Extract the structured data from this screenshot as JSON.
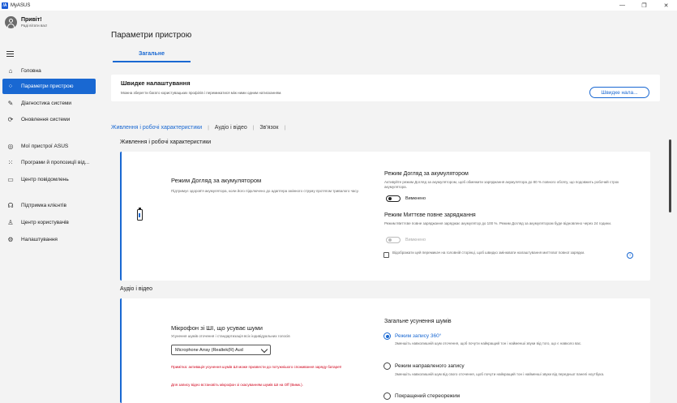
{
  "window": {
    "title": "MyASUS",
    "logo": "/A",
    "minimize": "—",
    "restore": "❐",
    "close": "✕"
  },
  "user": {
    "name": "Привіт!",
    "subtitle": "Раді вітати вас!"
  },
  "sidebar": {
    "items": [
      {
        "label": "Головна",
        "icon": "home-icon",
        "glyph": "⌂"
      },
      {
        "label": "Параметри пристрою",
        "icon": "grid-icon",
        "glyph": "⁘"
      },
      {
        "label": "Діагностика системи",
        "icon": "wrench-icon",
        "glyph": "✎"
      },
      {
        "label": "Оновлення системи",
        "icon": "update-icon",
        "glyph": "⟳"
      },
      {
        "label": "Мої пристрої ASUS",
        "icon": "devices-icon",
        "glyph": "◎"
      },
      {
        "label": "Програми й пропозиції від...",
        "icon": "apps-icon",
        "glyph": "⁙"
      },
      {
        "label": "Центр повідомлень",
        "icon": "message-icon",
        "glyph": "▭"
      },
      {
        "label": "Підтримка клієнтів",
        "icon": "support-icon",
        "glyph": "☊"
      },
      {
        "label": "Центр користувачів",
        "icon": "user-icon",
        "glyph": "♙"
      },
      {
        "label": "Налаштування",
        "icon": "gear-icon",
        "glyph": "⚙"
      }
    ]
  },
  "main": {
    "title": "Параметри пристрою",
    "tab_general": "Загальне",
    "quick": {
      "title": "Швидке налаштування",
      "desc": "Можна зберегти багато користувацьких профілів і перемикатися між ними одним натисканням.",
      "button": "Швидке нала..."
    },
    "subtabs": [
      "Живлення і робочі характеристики",
      "Аудіо і відео",
      "Зв'язок"
    ],
    "section1_label": "Живлення і робочі характеристики",
    "power": {
      "left_title": "Режим Догляд за акумулятором",
      "left_desc": "Підтримує здоров'я акумулятора, коли його підключено до адаптера змінного струму протягом тривалого часу.",
      "battery_title": "Режим Догляд за акумулятором",
      "battery_desc": "Активуйте режим Догляд за акумулятором, щоб обмежити заряджання акумулятора до 80 % повного обсягу, що подовжить робочий строк акумулятора.",
      "battery_toggle": "Вимкнено",
      "instant_title": "Режим Миттєве повне заряджання",
      "instant_desc": "Режим Миттєве повне заряджання заряджає акумулятор до 100 %. Режим Догляд за акумулятором буде відновлено через 24 години.",
      "instant_toggle": "Вимкнено",
      "checkbox_label": "Відображати цей перемикач на головній сторінці, щоб швидко змінювати налаштування миттєвої повної зарядки.",
      "info": "i"
    },
    "section2_label": "Аудіо і відео",
    "audio": {
      "mic_title": "Мікрофон зі ШІ, що усуває шуми",
      "mic_desc": "Усунення шумів оточення і стандартизація всіх індивідуальних голосів",
      "mic_select": "Microphone Array (Realtek(R) Aud",
      "warn1": "Примітка: активація усунення шумів ШІ може призвести до потужнішого споживання заряду батареї!",
      "warn2": "Для запису відео встановіть мікрофон зі скасуванням шумів ШІ на Off (Вимк.).",
      "general_title": "Загальне усунення шумів",
      "opt1": "Режим запису 360°",
      "opt1_desc": "Зменшіть навколишній шум оточення, щоб почути найкращий тон і найменші звуки від того, що є навколо вас.",
      "opt2": "Режим направленого запису",
      "opt2_desc": "Зменшіть навколишній шум від свого оточення, щоб почути найкращий тон і найменші звуки від передньої панелі ноутбука.",
      "opt3": "Покращений стереорежим"
    }
  }
}
